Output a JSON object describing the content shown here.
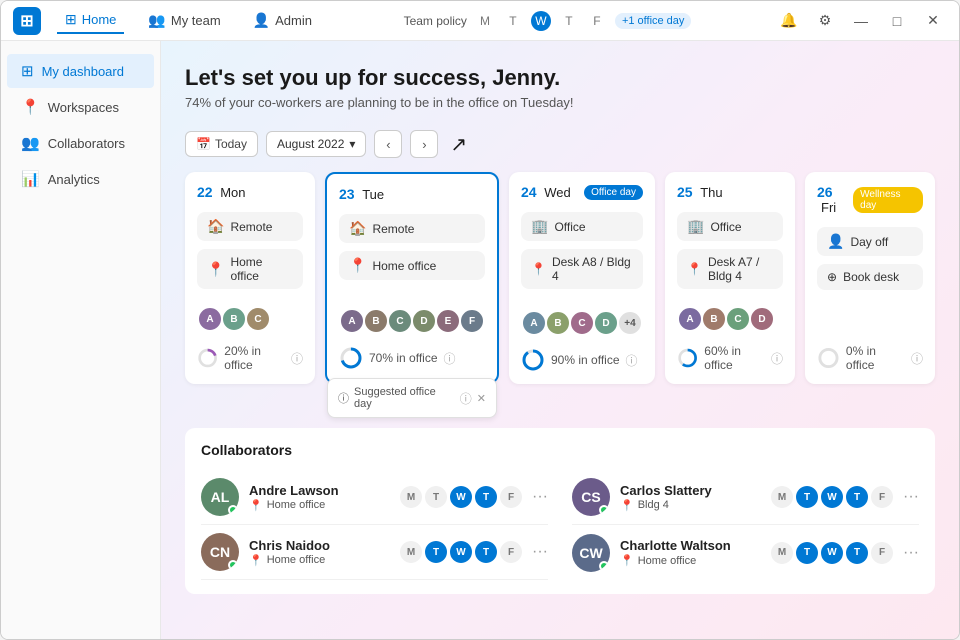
{
  "titleBar": {
    "tabs": [
      {
        "id": "home",
        "label": "Home",
        "icon": "⊞",
        "active": true
      },
      {
        "id": "myteam",
        "label": "My team",
        "icon": "👥",
        "active": false
      },
      {
        "id": "admin",
        "label": "Admin",
        "icon": "👤",
        "active": false
      }
    ],
    "teamPolicy": "Team policy",
    "days": [
      {
        "letter": "M",
        "active": false
      },
      {
        "letter": "T",
        "active": false
      },
      {
        "letter": "W",
        "active": true
      },
      {
        "letter": "T",
        "active": false
      },
      {
        "letter": "F",
        "active": false
      }
    ],
    "officeDayBadge": "+1 office day",
    "windowControls": {
      "minimize": "—",
      "restore": "□",
      "close": "✕"
    }
  },
  "sidebar": {
    "items": [
      {
        "id": "dashboard",
        "label": "My dashboard",
        "icon": "⊞",
        "active": true
      },
      {
        "id": "workspaces",
        "label": "Workspaces",
        "icon": "📍",
        "active": false
      },
      {
        "id": "collaborators",
        "label": "Collaborators",
        "icon": "👥",
        "active": false
      },
      {
        "id": "analytics",
        "label": "Analytics",
        "icon": "📊",
        "active": false
      }
    ]
  },
  "content": {
    "welcomeTitle": "Let's set you up for success, Jenny.",
    "welcomeSubtitle": "74% of your co-workers are planning to be in the office on Tuesday!",
    "calendarControls": {
      "todayLabel": "Today",
      "month": "August 2022"
    },
    "dayCards": [
      {
        "dayNum": "22",
        "dayName": "Mon",
        "tag": null,
        "locations": [
          "Remote",
          "Home office"
        ],
        "locationIcons": [
          "🏠",
          "📍"
        ],
        "desk": null,
        "avatarColors": [
          "#8B6BA0",
          "#6BA08B",
          "#A08B6B"
        ],
        "avatarInitials": [
          "A",
          "B",
          "C"
        ],
        "pct": "20%",
        "pctLabel": "20% in office",
        "pctValue": 20,
        "extraCount": null
      },
      {
        "dayNum": "23",
        "dayName": "Tue",
        "tag": null,
        "locations": [
          "Remote",
          "Home office"
        ],
        "locationIcons": [
          "🏠",
          "📍"
        ],
        "desk": null,
        "avatarColors": [
          "#7B6B8B",
          "#8B7B6B",
          "#6B8B7B",
          "#7B8B6B",
          "#8B6B7B",
          "#6B7B8B"
        ],
        "avatarInitials": [
          "A",
          "B",
          "C",
          "D",
          "E",
          "F"
        ],
        "pct": "70%",
        "pctLabel": "70% in office",
        "pctValue": 70,
        "extraCount": null,
        "highlighted": true,
        "suggestedOffice": "Suggested office day"
      },
      {
        "dayNum": "24",
        "dayName": "Wed",
        "tag": "Office day",
        "tagType": "office",
        "locations": [
          "Office"
        ],
        "locationIcons": [
          "🏢"
        ],
        "desk": "Desk A8 / Bldg 4",
        "avatarColors": [
          "#6B8BA0",
          "#8BA06B",
          "#A06B8B",
          "#6BA08B"
        ],
        "avatarInitials": [
          "A",
          "B",
          "C",
          "D"
        ],
        "pct": "90%",
        "pctLabel": "90% in office",
        "pctValue": 90,
        "extraCount": "+4"
      },
      {
        "dayNum": "25",
        "dayName": "Thu",
        "tag": null,
        "locations": [
          "Office"
        ],
        "locationIcons": [
          "🏢"
        ],
        "desk": "Desk A7 / Bldg 4",
        "avatarColors": [
          "#7B6BA0",
          "#A07B6B",
          "#6BA07B",
          "#A06B7B"
        ],
        "avatarInitials": [
          "A",
          "B",
          "C",
          "D"
        ],
        "pct": "60%",
        "pctLabel": "60% in office",
        "pctValue": 60,
        "extraCount": null
      },
      {
        "dayNum": "26",
        "dayName": "Fri",
        "tag": "Wellness day",
        "tagType": "wellness",
        "locations": [
          "Day off"
        ],
        "locationIcons": [
          "👤"
        ],
        "desk": null,
        "bookDesk": "Book desk",
        "avatarColors": [],
        "avatarInitials": [],
        "pct": "0%",
        "pctLabel": "0% in office",
        "pctValue": 0,
        "extraCount": null
      }
    ],
    "collaborators": {
      "title": "Collaborators",
      "items": [
        {
          "name": "Andre Lawson",
          "location": "Home office",
          "locationIcon": "📍",
          "avatarColor": "#5B8A6B",
          "initials": "AL",
          "onlineDot": "#22c55e",
          "days": [
            "M",
            "T",
            "W",
            "T",
            "F"
          ],
          "highlightDays": [
            "W",
            "T"
          ]
        },
        {
          "name": "Carlos Slattery",
          "location": "Bldg 4",
          "locationIcon": "📍",
          "avatarColor": "#6B5B8A",
          "initials": "CS",
          "onlineDot": "#22c55e",
          "days": [
            "M",
            "T",
            "W",
            "T",
            "F"
          ],
          "highlightDays": [
            "T",
            "W",
            "T"
          ]
        },
        {
          "name": "Chris Naidoo",
          "location": "Home office",
          "locationIcon": "📍",
          "avatarColor": "#8A6B5B",
          "initials": "CN",
          "onlineDot": "#22c55e",
          "days": [
            "M",
            "T",
            "W",
            "T",
            "F"
          ],
          "highlightDays": [
            "T",
            "W",
            "T"
          ]
        },
        {
          "name": "Charlotte Waltson",
          "location": "Home office",
          "locationIcon": "📍",
          "avatarColor": "#5B6B8A",
          "initials": "CW",
          "onlineDot": "#22c55e",
          "days": [
            "M",
            "T",
            "W",
            "T",
            "F"
          ],
          "highlightDays": [
            "T",
            "W",
            "T"
          ]
        }
      ]
    }
  }
}
